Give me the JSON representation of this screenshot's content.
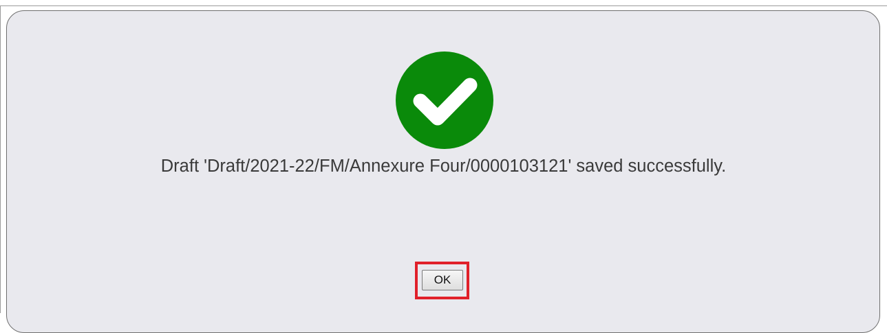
{
  "dialog": {
    "icon": "check-circle-icon",
    "icon_color": "#0a8a0a",
    "message": "Draft 'Draft/2021-22/FM/Annexure Four/0000103121' saved successfully.",
    "ok_label": "OK",
    "highlight_color": "#e0202a"
  }
}
